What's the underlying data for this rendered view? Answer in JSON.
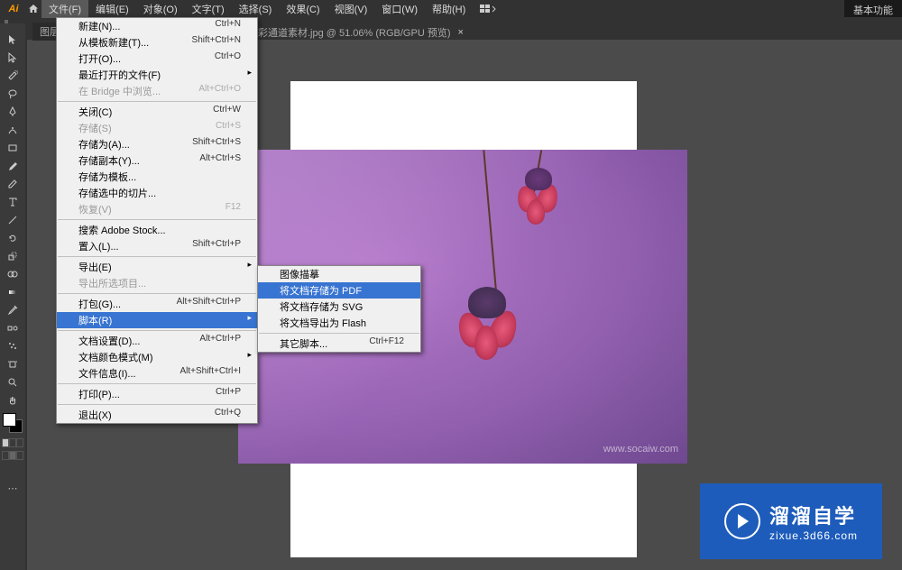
{
  "app": {
    "name": "Ai"
  },
  "menubar": {
    "items": [
      {
        "label": "文件(F)"
      },
      {
        "label": "编辑(E)"
      },
      {
        "label": "对象(O)"
      },
      {
        "label": "文字(T)"
      },
      {
        "label": "选择(S)"
      },
      {
        "label": "效果(C)"
      },
      {
        "label": "视图(V)"
      },
      {
        "label": "窗口(W)"
      },
      {
        "label": "帮助(H)"
      }
    ],
    "basic": "基本功能"
  },
  "tab": {
    "prefix": "图层",
    "title": "彩通道素材.jpg @ 51.06% (RGB/GPU 预览)"
  },
  "file_menu": {
    "new": {
      "label": "新建(N)...",
      "sc": "Ctrl+N"
    },
    "new_tpl": {
      "label": "从模板新建(T)...",
      "sc": "Shift+Ctrl+N"
    },
    "open": {
      "label": "打开(O)...",
      "sc": "Ctrl+O"
    },
    "open_recent": {
      "label": "最近打开的文件(F)"
    },
    "browse_bridge": {
      "label": "在 Bridge 中浏览...",
      "sc": "Alt+Ctrl+O"
    },
    "close": {
      "label": "关闭(C)",
      "sc": "Ctrl+W"
    },
    "save": {
      "label": "存储(S)",
      "sc": "Ctrl+S"
    },
    "save_as": {
      "label": "存储为(A)...",
      "sc": "Shift+Ctrl+S"
    },
    "save_copy": {
      "label": "存储副本(Y)...",
      "sc": "Alt+Ctrl+S"
    },
    "save_tpl": {
      "label": "存储为模板..."
    },
    "save_sel": {
      "label": "存储选中的切片..."
    },
    "revert": {
      "label": "恢复(V)",
      "sc": "F12"
    },
    "search_stock": {
      "label": "搜索 Adobe Stock..."
    },
    "place": {
      "label": "置入(L)...",
      "sc": "Shift+Ctrl+P"
    },
    "export": {
      "label": "导出(E)"
    },
    "export_sel": {
      "label": "导出所选项目..."
    },
    "package": {
      "label": "打包(G)...",
      "sc": "Alt+Shift+Ctrl+P"
    },
    "script": {
      "label": "脚本(R)"
    },
    "doc_setup": {
      "label": "文档设置(D)...",
      "sc": "Alt+Ctrl+P"
    },
    "color_mode": {
      "label": "文档颜色模式(M)"
    },
    "file_info": {
      "label": "文件信息(I)...",
      "sc": "Alt+Shift+Ctrl+I"
    },
    "print": {
      "label": "打印(P)...",
      "sc": "Ctrl+P"
    },
    "exit": {
      "label": "退出(X)",
      "sc": "Ctrl+Q"
    }
  },
  "script_submenu": {
    "trace": {
      "label": "图像描摹"
    },
    "save_pdf": {
      "label": "将文档存储为 PDF"
    },
    "save_svg": {
      "label": "将文档存储为 SVG"
    },
    "export_flash": {
      "label": "将文档导出为 Flash"
    },
    "other": {
      "label": "其它脚本...",
      "sc": "Ctrl+F12"
    }
  },
  "watermark": "www.socaiw.com",
  "brand": {
    "big": "溜溜自学",
    "small": "zixue.3d66.com"
  }
}
